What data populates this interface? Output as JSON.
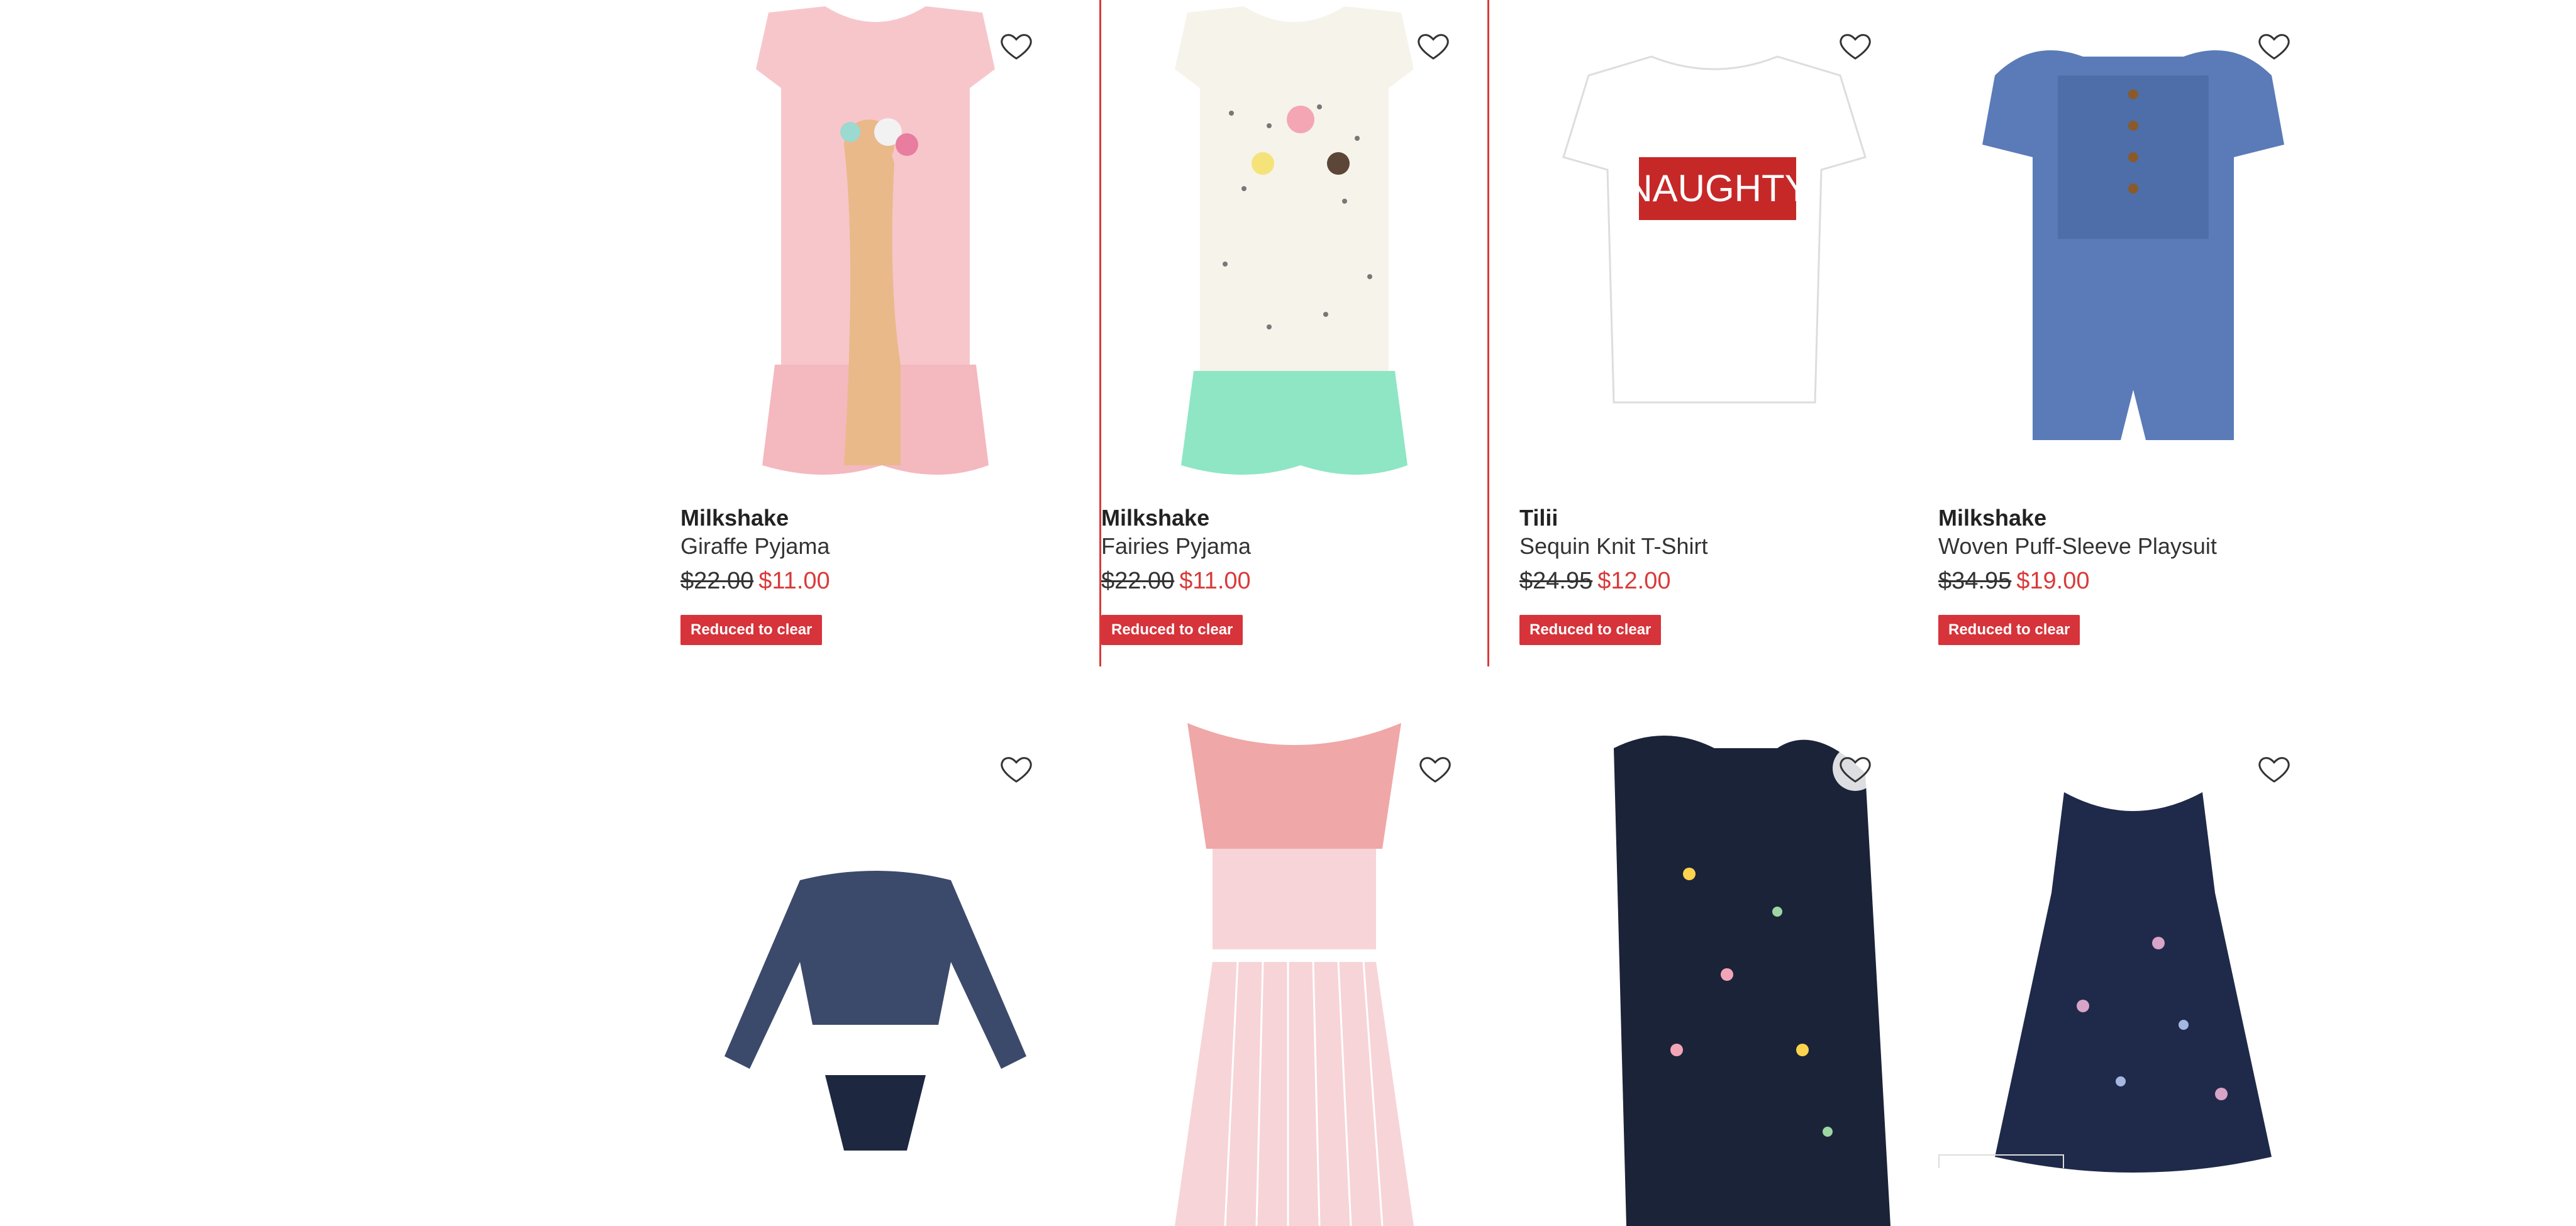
{
  "products_row1": [
    {
      "brand": "Milkshake",
      "name": "Giraffe Pyjama",
      "was": "$22.00",
      "now": "$11.00",
      "badge": "Reduced to clear"
    },
    {
      "brand": "Milkshake",
      "name": "Fairies Pyjama",
      "was": "$22.00",
      "now": "$11.00",
      "badge": "Reduced to clear"
    },
    {
      "brand": "Tilii",
      "name": "Sequin Knit T-Shirt",
      "was": "$24.95",
      "now": "$12.00",
      "badge": "Reduced to clear"
    },
    {
      "brand": "Milkshake",
      "name": "Woven Puff-Sleeve Playsuit",
      "was": "$34.95",
      "now": "$19.00",
      "badge": "Reduced to clear"
    }
  ],
  "tshirt_print": "NAUGHTY",
  "icons": {
    "wishlist": "heart-outline-icon"
  },
  "colors": {
    "sale_red": "#d93a3a",
    "badge_bg": "#d6333a"
  }
}
